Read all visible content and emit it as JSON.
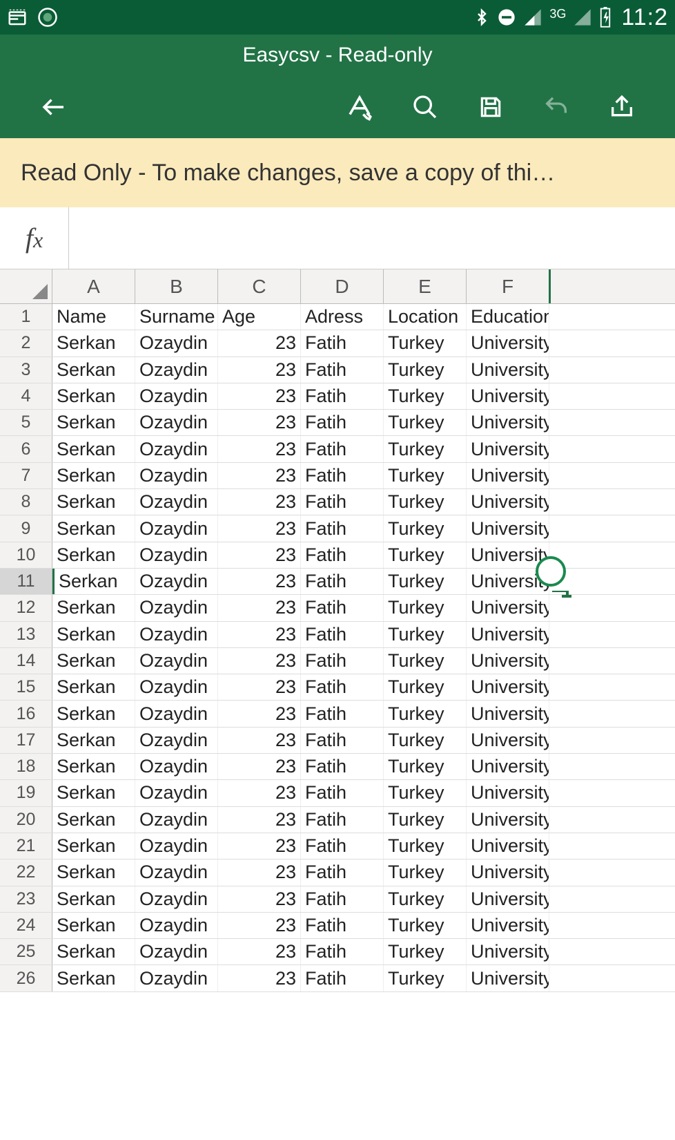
{
  "status_bar": {
    "network_label": "3G",
    "time": "11:2"
  },
  "header": {
    "title": "Easycsv - Read-only"
  },
  "info_banner": "Read Only - To make changes, save a copy of thi…",
  "formula_bar": {
    "fx": "fx",
    "value": ""
  },
  "columns": [
    "A",
    "B",
    "C",
    "D",
    "E",
    "F"
  ],
  "header_row": [
    "Name",
    "Surname",
    "Age",
    "Adress",
    "Location",
    "Education"
  ],
  "data_row": [
    "Serkan",
    "Ozaydin",
    "23",
    "Fatih",
    "Turkey",
    "University"
  ],
  "row_numbers": [
    "1",
    "2",
    "3",
    "4",
    "5",
    "6",
    "7",
    "8",
    "9",
    "10",
    "11",
    "12",
    "13",
    "14",
    "15",
    "16",
    "17",
    "18",
    "19",
    "20",
    "21",
    "22",
    "23",
    "24",
    "25",
    "26"
  ],
  "selected_row": 11
}
